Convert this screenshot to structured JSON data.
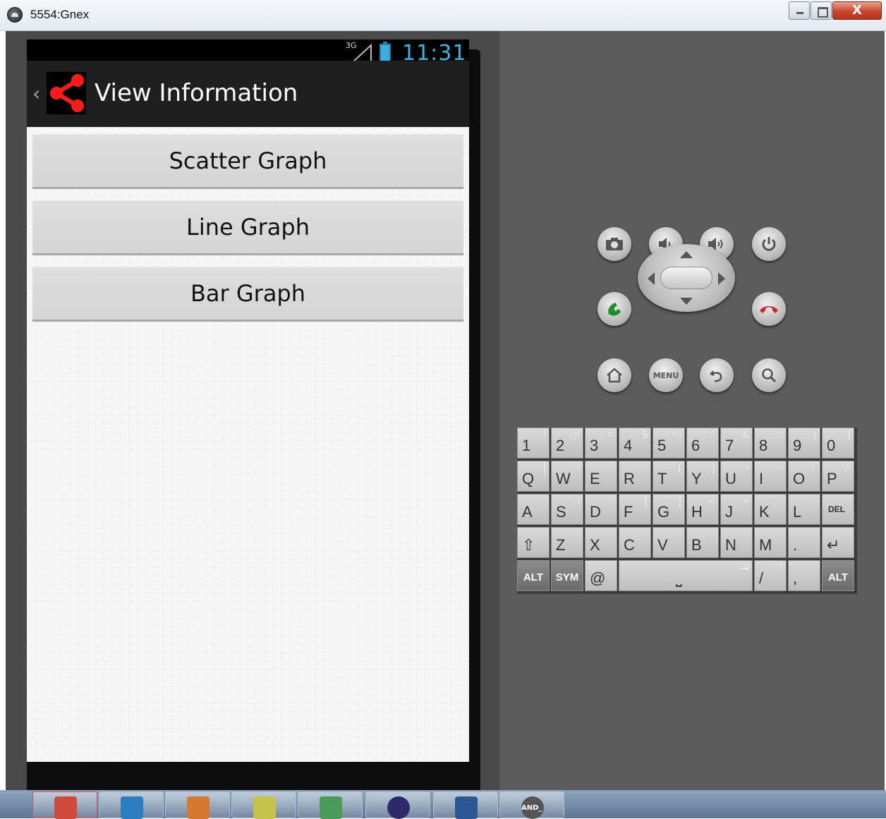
{
  "window": {
    "title": "5554:Gnex",
    "close_label": "X"
  },
  "statusbar": {
    "network": "3G",
    "time": "11:31"
  },
  "actionbar": {
    "back_glyph": "‹",
    "title": "View Information"
  },
  "menu": {
    "items": [
      {
        "label": "Scatter Graph"
      },
      {
        "label": "Line Graph"
      },
      {
        "label": "Bar Graph"
      }
    ]
  },
  "controls": {
    "menu_label": "MENU"
  },
  "keyboard": {
    "rows": [
      [
        {
          "m": "1",
          "a": "!"
        },
        {
          "m": "2",
          "a": "@"
        },
        {
          "m": "3",
          "a": "#"
        },
        {
          "m": "4",
          "a": "$"
        },
        {
          "m": "5",
          "a": "%"
        },
        {
          "m": "6",
          "a": "^"
        },
        {
          "m": "7",
          "a": "&"
        },
        {
          "m": "8",
          "a": "*"
        },
        {
          "m": "9",
          "a": "("
        },
        {
          "m": "0",
          "a": ")"
        }
      ],
      [
        {
          "m": "Q",
          "a": "|"
        },
        {
          "m": "W",
          "a": "~"
        },
        {
          "m": "E",
          "a": "\""
        },
        {
          "m": "R",
          "a": "`"
        },
        {
          "m": "T",
          "a": "{"
        },
        {
          "m": "Y",
          "a": "}"
        },
        {
          "m": "U",
          "a": "-"
        },
        {
          "m": "I",
          "a": "-"
        },
        {
          "m": "O",
          "a": "+"
        },
        {
          "m": "P",
          "a": "="
        }
      ],
      [
        {
          "m": "A",
          "a": ""
        },
        {
          "m": "S",
          "a": "\\"
        },
        {
          "m": "D",
          "a": "'"
        },
        {
          "m": "F",
          "a": "["
        },
        {
          "m": "G",
          "a": "]"
        },
        {
          "m": "H",
          "a": "<"
        },
        {
          "m": "J",
          "a": ">"
        },
        {
          "m": "K",
          "a": ";"
        },
        {
          "m": "L",
          "a": ":"
        },
        {
          "m": "DEL",
          "a": ""
        }
      ],
      [
        {
          "m": "⇧",
          "a": ""
        },
        {
          "m": "Z",
          "a": ""
        },
        {
          "m": "X",
          "a": ""
        },
        {
          "m": "C",
          "a": ""
        },
        {
          "m": "V",
          "a": ""
        },
        {
          "m": "B",
          "a": ""
        },
        {
          "m": "N",
          "a": ""
        },
        {
          "m": "M",
          "a": ""
        },
        {
          "m": ".",
          "a": ""
        },
        {
          "m": "↵",
          "a": ""
        }
      ]
    ],
    "bottom": {
      "alt_left": "ALT",
      "sym": "SYM",
      "at": "@",
      "space": "⎵",
      "tab": "⇥",
      "slash": "/",
      "question": "?",
      "comma": ",",
      "alt_right": "ALT"
    }
  },
  "taskbar": {
    "items": [
      {
        "icon": "snipping-tool-icon",
        "color": "#d04a3c"
      },
      {
        "icon": "hp-icon",
        "color": "#2a7fc1"
      },
      {
        "icon": "photos-icon",
        "color": "#d4792f"
      },
      {
        "icon": "sticky-notes-icon",
        "color": "#c8c24a"
      },
      {
        "icon": "messenger-icon",
        "color": "#4a9a5a"
      },
      {
        "icon": "eclipse-icon",
        "color": "#2c2a6a"
      },
      {
        "icon": "word-icon",
        "color": "#2b5797"
      },
      {
        "icon": "android-icon",
        "color": "#555555"
      }
    ],
    "android_label": "AND_"
  }
}
